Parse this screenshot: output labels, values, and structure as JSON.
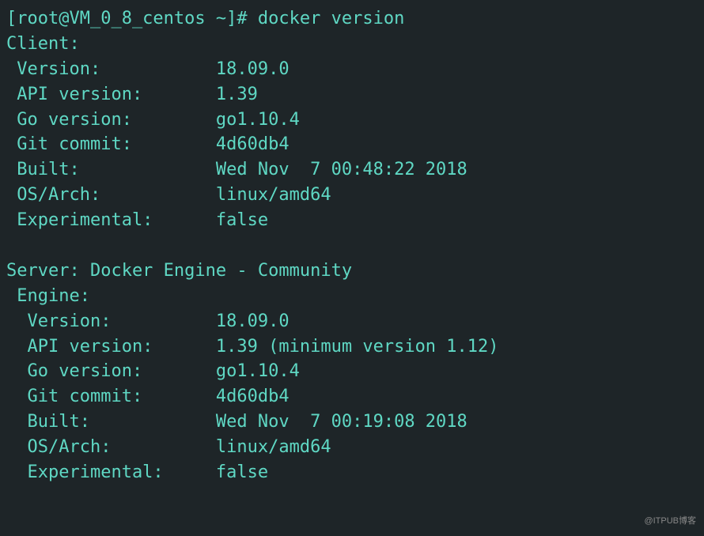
{
  "prompt": "[root@VM_0_8_centos ~]# ",
  "command": "docker version",
  "client": {
    "header": "Client:",
    "version_label": " Version:           ",
    "version_value": "18.09.0",
    "api_label": " API version:       ",
    "api_value": "1.39",
    "go_label": " Go version:        ",
    "go_value": "go1.10.4",
    "git_label": " Git commit:        ",
    "git_value": "4d60db4",
    "built_label": " Built:             ",
    "built_value": "Wed Nov  7 00:48:22 2018",
    "os_label": " OS/Arch:           ",
    "os_value": "linux/amd64",
    "exp_label": " Experimental:      ",
    "exp_value": "false"
  },
  "server": {
    "header": "Server: Docker Engine - Community",
    "engine_header": " Engine:",
    "version_label": "  Version:          ",
    "version_value": "18.09.0",
    "api_label": "  API version:      ",
    "api_value": "1.39 (minimum version 1.12)",
    "go_label": "  Go version:       ",
    "go_value": "go1.10.4",
    "git_label": "  Git commit:       ",
    "git_value": "4d60db4",
    "built_label": "  Built:            ",
    "built_value": "Wed Nov  7 00:19:08 2018",
    "os_label": "  OS/Arch:          ",
    "os_value": "linux/amd64",
    "exp_label": "  Experimental:     ",
    "exp_value": "false"
  },
  "watermark": "@ITPUB博客"
}
